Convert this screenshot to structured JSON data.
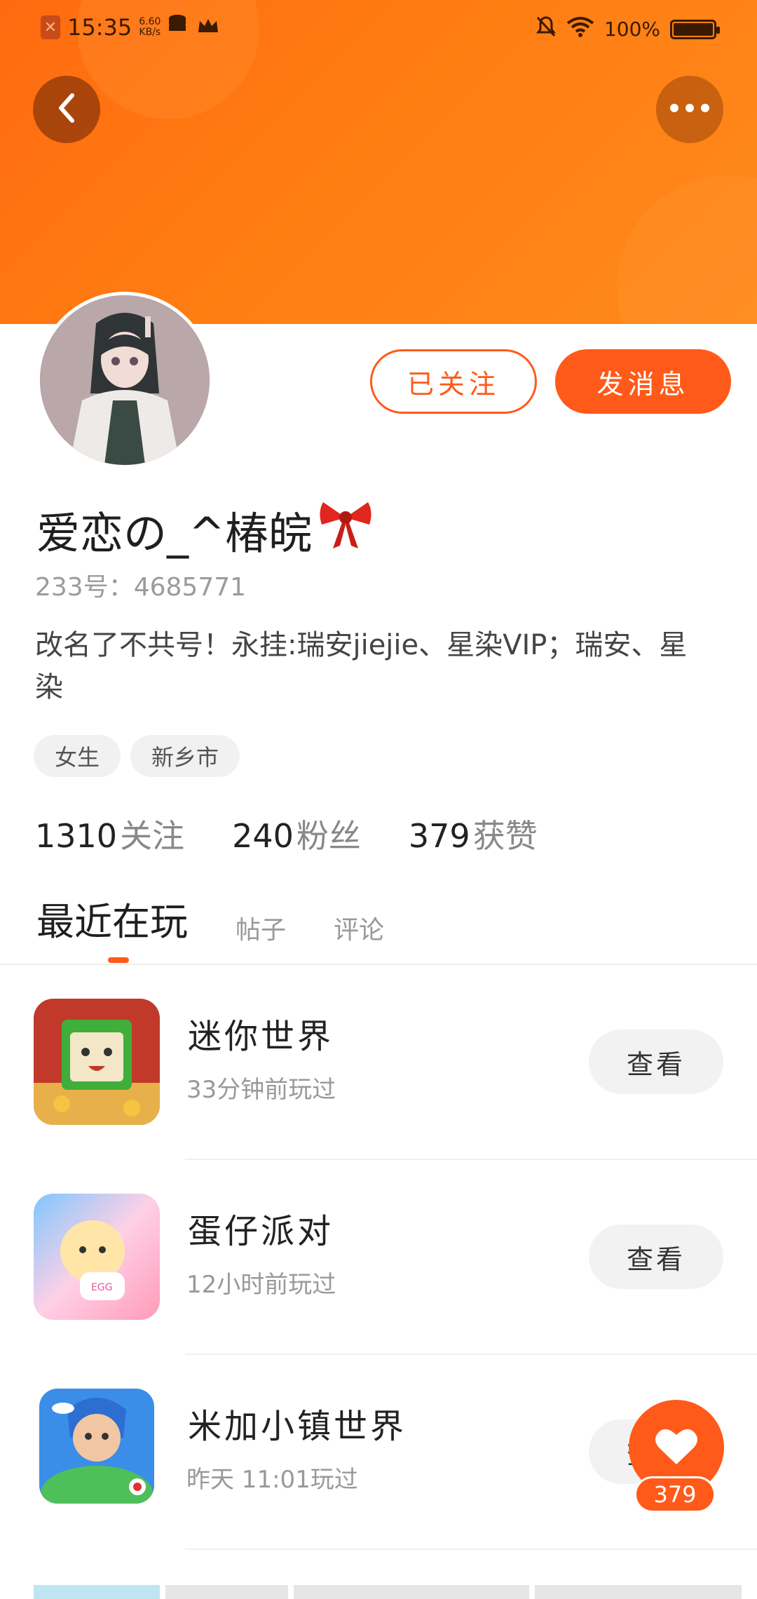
{
  "status_bar": {
    "time": "15:35",
    "speed_value": "6.60",
    "speed_unit": "KB/s",
    "battery": "100%",
    "battery_level": 1.0
  },
  "header": {
    "back_icon": "chevron-left-icon",
    "more_icon": "more-horizontal-icon"
  },
  "profile": {
    "follow_label": "已关注",
    "message_label": "发消息",
    "username": "爱恋の_^椿皖",
    "id_text": "233号：4685771",
    "bio": "改名了不共号！永挂:瑞安jiejie、星染VIP；瑞安、星染",
    "tags": [
      "女生",
      "新乡市"
    ],
    "stats": [
      {
        "num": "1310",
        "label": "关注"
      },
      {
        "num": "240",
        "label": "粉丝"
      },
      {
        "num": "379",
        "label": "获赞"
      }
    ]
  },
  "tabs": [
    {
      "label": "最近在玩",
      "active": true
    },
    {
      "label": "帖子",
      "active": false
    },
    {
      "label": "评论",
      "active": false
    }
  ],
  "games": [
    {
      "name": "迷你世界",
      "time": "33分钟前玩过",
      "button": "查看"
    },
    {
      "name": "蛋仔派对",
      "time": "12小时前玩过",
      "button": "查看"
    },
    {
      "name": "米加小镇世界",
      "time": "昨天 11:01玩过",
      "button": "查看"
    }
  ],
  "like_fab": {
    "icon": "heart-icon",
    "count": "379"
  },
  "colors": {
    "accent": "#ff5a1a",
    "banner": "#ff7d12"
  }
}
